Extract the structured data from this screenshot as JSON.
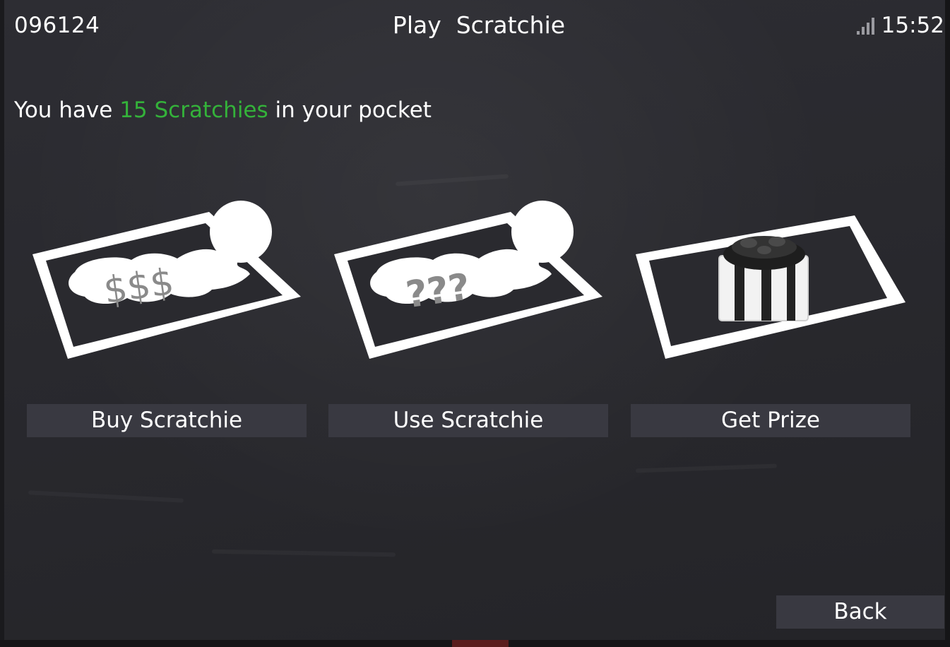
{
  "status_bar": {
    "id_number": "096124",
    "title": "Play  Scratchie",
    "time": "15:52",
    "signal_icon": "signal-bars-icon"
  },
  "pocket_message": {
    "prefix": "You have ",
    "highlight": "15 Scratchies",
    "suffix": " in your pocket",
    "highlight_color": "#34b23a"
  },
  "cards": [
    {
      "icon": "dollar-ticket-icon",
      "symbols": "$$$",
      "button_label": "Buy Scratchie"
    },
    {
      "icon": "question-ticket-icon",
      "symbols": "???",
      "button_label": "Use Scratchie"
    },
    {
      "icon": "gift-ticket-icon",
      "symbols": "",
      "button_label": "Get Prize"
    }
  ],
  "back_button": {
    "label": "Back"
  },
  "colors": {
    "background": "#2a2a2f",
    "button": "#393941",
    "accent_green": "#34b23a",
    "symbol_gray": "#8a8a8a"
  }
}
